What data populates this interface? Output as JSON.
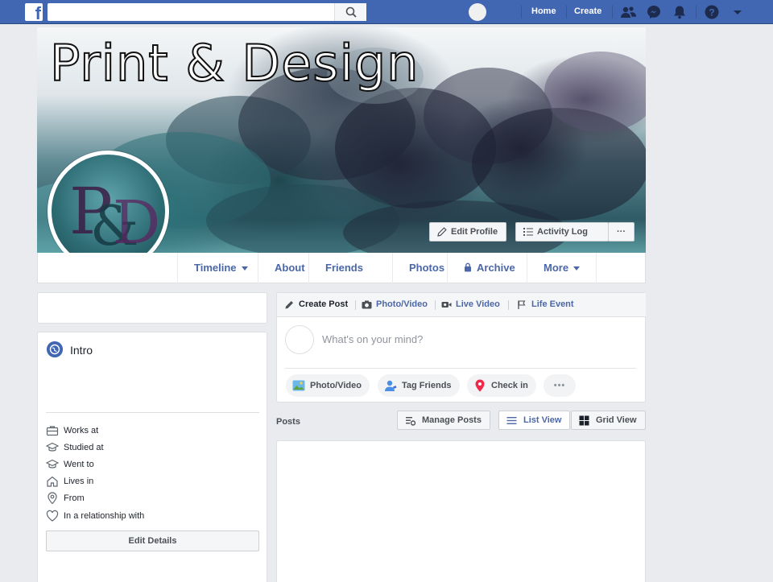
{
  "topbar": {
    "search_placeholder": "",
    "home_label": "Home",
    "create_label": "Create",
    "colors": {
      "brand": "#4267b2"
    }
  },
  "cover": {
    "title": "Print & Design",
    "edit_profile_label": "Edit Profile",
    "activity_log_label": "Activity Log",
    "more_label": "···"
  },
  "timeline_nav": {
    "tabs": [
      {
        "label": "Timeline"
      },
      {
        "label": "About"
      },
      {
        "label": "Friends"
      },
      {
        "label": "Photos"
      },
      {
        "label": "Archive"
      },
      {
        "label": "More"
      }
    ]
  },
  "intro": {
    "title": "Intro",
    "rows": [
      {
        "label": "Works at",
        "icon": "briefcase-icon"
      },
      {
        "label": "Studied at",
        "icon": "graduation-cap-icon"
      },
      {
        "label": "Went to",
        "icon": "graduation-cap-icon"
      },
      {
        "label": "Lives in",
        "icon": "home-icon"
      },
      {
        "label": "From",
        "icon": "location-pin-icon"
      },
      {
        "label": "In a relationship with",
        "icon": "heart-icon"
      }
    ],
    "edit_details_label": "Edit Details"
  },
  "composer": {
    "tabs": [
      {
        "label": "Create Post",
        "icon": "pencil-icon"
      },
      {
        "label": "Photo/Video",
        "icon": "camera-icon"
      },
      {
        "label": "Live Video",
        "icon": "video-camera-icon"
      },
      {
        "label": "Life Event",
        "icon": "flag-icon"
      }
    ],
    "placeholder": "What's on your mind?",
    "actions": [
      {
        "label": "Photo/Video",
        "icon": "photo-icon"
      },
      {
        "label": "Tag Friends",
        "icon": "tag-friends-icon"
      },
      {
        "label": "Check in",
        "icon": "location-pin-icon"
      },
      {
        "label": "•••",
        "icon": "more-icon"
      }
    ]
  },
  "posts": {
    "label": "Posts",
    "manage_label": "Manage Posts",
    "list_view_label": "List View",
    "grid_view_label": "Grid View"
  }
}
